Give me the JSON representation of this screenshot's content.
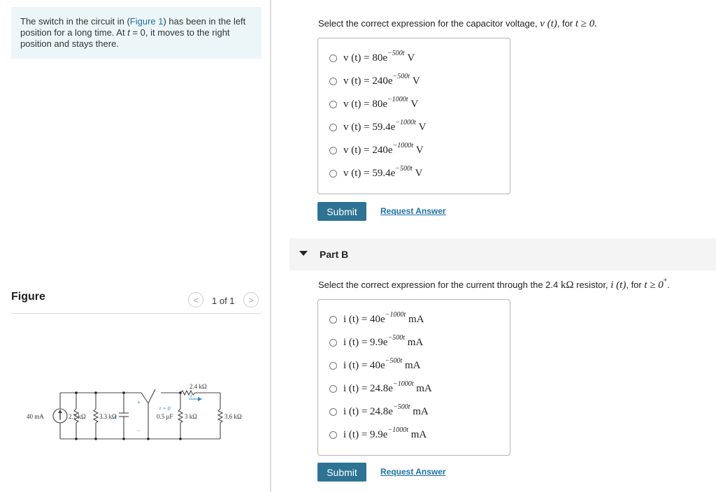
{
  "problem": {
    "text_before": "The switch in the circuit in (",
    "figure_link": "Figure 1",
    "text_after": ") has been in the left position for a long time. At ",
    "t_var": "t",
    "text_end": " = 0, it moves to the right position and stays there."
  },
  "figure": {
    "title": "Figure",
    "pager": "1 of 1",
    "prev_glyph": "<",
    "next_glyph": ">",
    "circuit_labels": {
      "source": "40 mA",
      "r1": "2.7 kΩ",
      "r2": "3.3 kΩ",
      "v_label": "v",
      "plus": "+",
      "minus": "−",
      "t0": "t = 0",
      "cap": "0.5 μF",
      "r3": "3 kΩ",
      "r4": "2.4 kΩ",
      "i_label": "i",
      "r5": "3.6 kΩ"
    }
  },
  "partA": {
    "prompt_text": "Select the correct expression for the capacitor voltage, ",
    "prompt_math": "v (t)",
    "prompt_for": ", for ",
    "prompt_cond": "t ≥ 0.",
    "options": [
      {
        "lhs": "v (t) = 80e",
        "exp": "−500t",
        "unit": "V"
      },
      {
        "lhs": "v (t) = 240e",
        "exp": "−500t",
        "unit": "V"
      },
      {
        "lhs": "v (t) = 80e",
        "exp": "−1000t",
        "unit": "V"
      },
      {
        "lhs": "v (t) = 59.4e",
        "exp": "−1000t",
        "unit": "V"
      },
      {
        "lhs": "v (t) = 240e",
        "exp": "−1000t",
        "unit": "V"
      },
      {
        "lhs": "v (t) = 59.4e",
        "exp": "−500t",
        "unit": "V"
      }
    ],
    "submit": "Submit",
    "request": "Request Answer"
  },
  "partB": {
    "label": "Part B",
    "prompt_text": "Select the correct expression for the current through the 2.4 ",
    "prompt_unit": "kΩ",
    "prompt_mid": " resistor, ",
    "prompt_math": "i (t)",
    "prompt_for": ", for ",
    "prompt_cond": "t ≥ 0",
    "prompt_sup": "+",
    "prompt_end": ".",
    "options": [
      {
        "lhs": "i (t) = 40e",
        "exp": "−1000t",
        "unit": "mA"
      },
      {
        "lhs": "i (t) = 9.9e",
        "exp": "−500t",
        "unit": "mA"
      },
      {
        "lhs": "i (t) = 40e",
        "exp": "−500t",
        "unit": "mA"
      },
      {
        "lhs": "i (t) = 24.8e",
        "exp": "−1000t",
        "unit": "mA"
      },
      {
        "lhs": "i (t) = 24.8e",
        "exp": "−500t",
        "unit": "mA"
      },
      {
        "lhs": "i (t) = 9.9e",
        "exp": "−1000t",
        "unit": "mA"
      }
    ],
    "submit": "Submit",
    "request": "Request Answer"
  }
}
